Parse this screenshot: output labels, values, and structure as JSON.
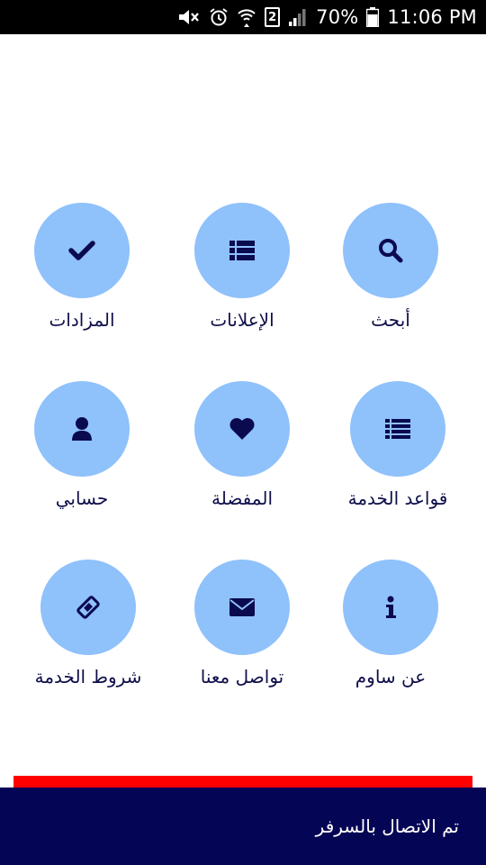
{
  "status_bar": {
    "battery_percent": "70%",
    "time": "11:06 PM",
    "sim_slot": "2",
    "icons": [
      "mute-icon",
      "alarm-icon",
      "wifi-icon",
      "sim-2-icon",
      "signal-icon",
      "battery-icon"
    ]
  },
  "menu": {
    "items": [
      {
        "label": "المزادات",
        "icon": "check-icon"
      },
      {
        "label": "الإعلانات",
        "icon": "list-icon"
      },
      {
        "label": "أبحث",
        "icon": "search-icon"
      },
      {
        "label": "حسابي",
        "icon": "user-icon"
      },
      {
        "label": "المفضلة",
        "icon": "heart-icon"
      },
      {
        "label": "قواعد الخدمة",
        "icon": "list-icon"
      },
      {
        "label": "شروط الخدمة",
        "icon": "ticket-icon"
      },
      {
        "label": "تواصل معنا",
        "icon": "envelope-icon"
      },
      {
        "label": "عن ساوم",
        "icon": "info-icon"
      }
    ]
  },
  "snackbar": {
    "message": "تم الاتصال بالسرفر"
  },
  "colors": {
    "circle_bg": "#8fc1fb",
    "icon_color": "#0a0a4f",
    "label_color": "#0f0f4a",
    "alert_bar": "#ff0000",
    "snackbar_bg": "#050555"
  }
}
